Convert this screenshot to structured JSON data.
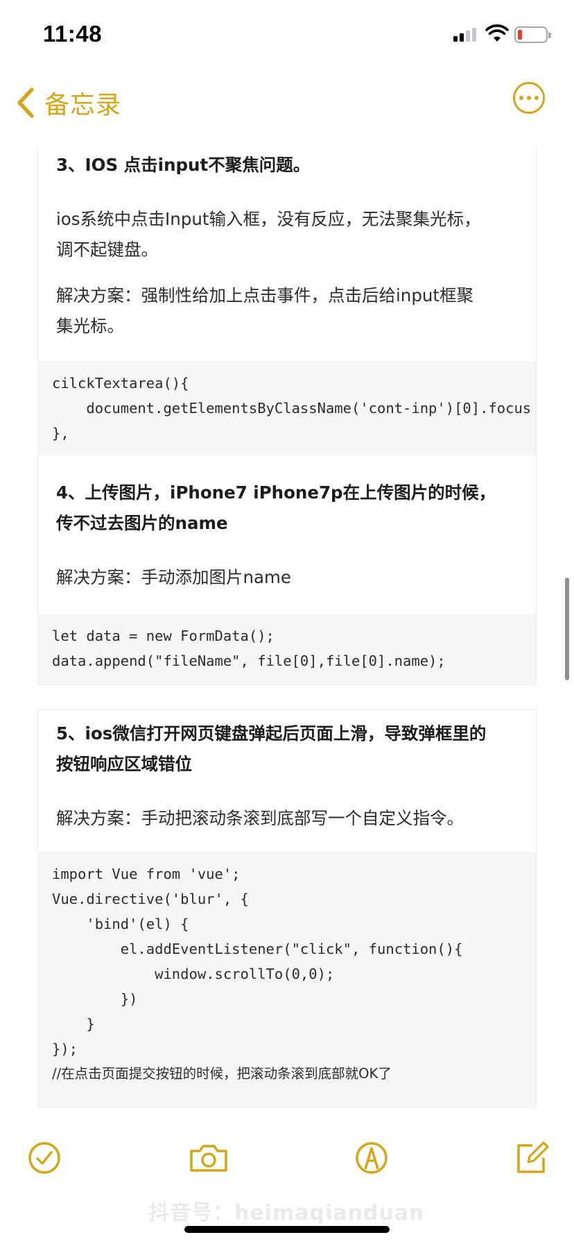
{
  "status_bar": {
    "time": "11:48"
  },
  "nav": {
    "back_label": "备忘录"
  },
  "note": {
    "section3": {
      "heading": "3、IOS 点击input不聚焦问题。",
      "desc_lines": [
        "ios系统中点击Input输入框，没有反应，无法聚集光标，",
        "调不起键盘。"
      ],
      "solution_lines": [
        "解决方案：强制性给加上点击事件，点击后给input框聚",
        "集光标。"
      ],
      "code": [
        "cilckTextarea(){",
        "    document.getElementsByClassName('cont-inp')[0].focus",
        "},"
      ]
    },
    "section4": {
      "heading_lines": [
        "4、上传图片，iPhone7 iPhone7p在上传图片的时候，",
        "传不过去图片的name"
      ],
      "solution": "解决方案：手动添加图片name",
      "code": [
        "let data = new FormData();",
        "data.append(\"fileName\", file[0],file[0].name);"
      ]
    },
    "section5": {
      "heading_lines": [
        "5、ios微信打开网页键盘弹起后页面上滑，导致弹框里的",
        "按钮响应区域错位"
      ],
      "solution": "解决方案：手动把滚动条滚到底部写一个自定义指令。",
      "code": [
        "import Vue from 'vue';",
        "Vue.directive('blur', {",
        "    'bind'(el) {",
        "        el.addEventListener(\"click\", function(){",
        "            window.scrollTo(0,0);",
        "        })",
        "    }",
        "});"
      ],
      "code_comment": "//在点击页面提交按钮的时候，把滚动条滚到底部就OK了"
    }
  },
  "toolbar": {
    "icons": [
      "checklist-icon",
      "camera-icon",
      "markup-icon",
      "compose-icon"
    ]
  },
  "watermark": "抖音号：heimaqianduan",
  "colors": {
    "accent": "#d4a61b",
    "code_bg": "#f6f6f7",
    "battery_low": "#e63b2e"
  }
}
